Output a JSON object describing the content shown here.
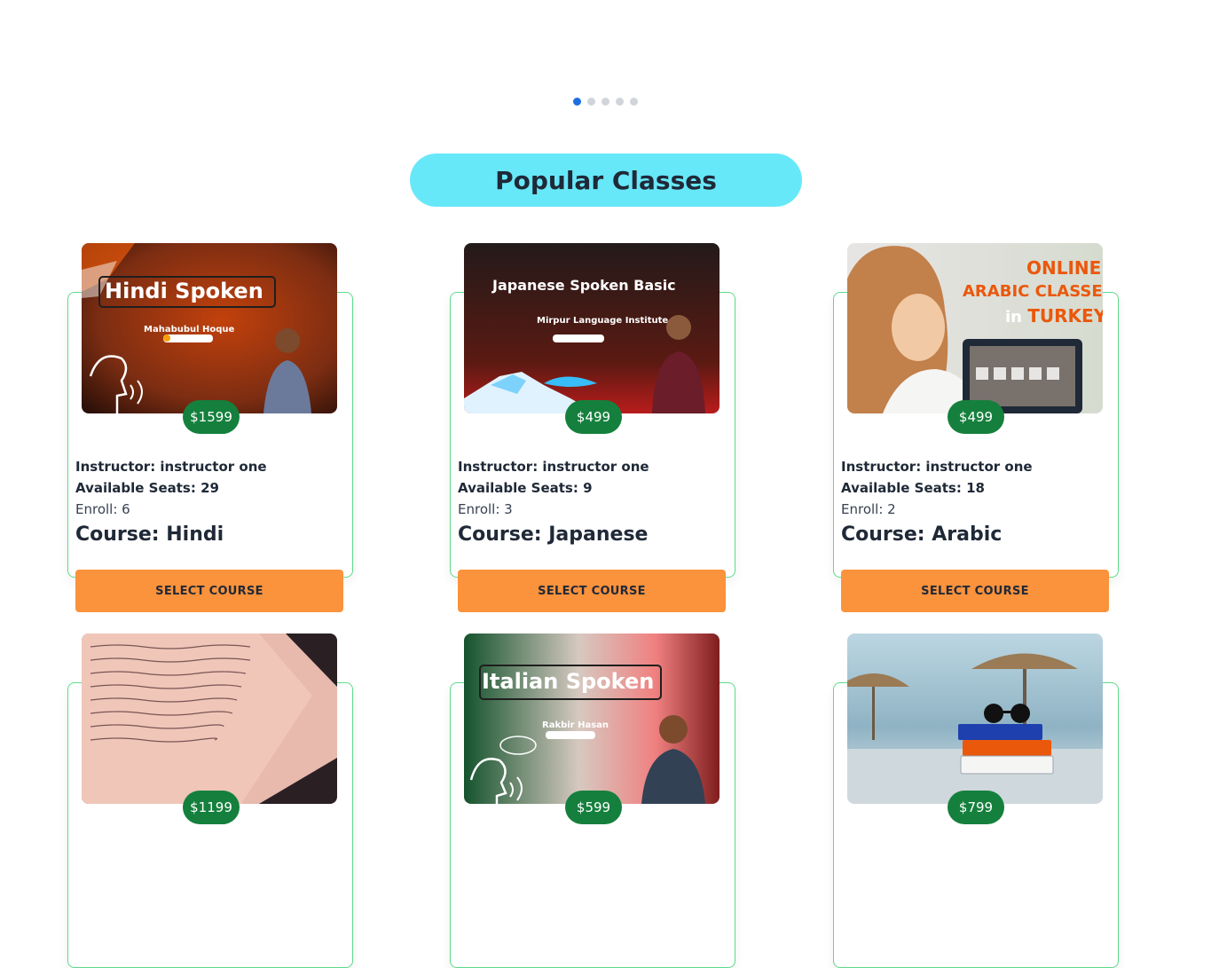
{
  "carousel": {
    "dot_count": 5,
    "active_index": 0
  },
  "section": {
    "title": "Popular Classes"
  },
  "labels": {
    "instructor_prefix": "Instructor: ",
    "seats_prefix": "Available Seats: ",
    "enroll_prefix": "Enroll: ",
    "course_prefix": "Course: ",
    "select_button": "SELECT COURSE"
  },
  "classes": [
    {
      "price": "$1599",
      "instructor": "Instructor: instructor one",
      "seats": "Available Seats: 29",
      "enroll": "Enroll: 6",
      "course": "Course: Hindi",
      "banner_title": "Hindi Spoken",
      "banner_sub": "Mahabubul Hoque"
    },
    {
      "price": "$499",
      "instructor": "Instructor: instructor one",
      "seats": "Available Seats: 9",
      "enroll": "Enroll: 3",
      "course": "Course: Japanese",
      "banner_title": "Japanese Spoken Basic",
      "banner_sub": "Mirpur Language Institute"
    },
    {
      "price": "$499",
      "instructor": "Instructor: instructor one",
      "seats": "Available Seats: 18",
      "enroll": "Enroll: 2",
      "course": "Course: Arabic",
      "banner_line1": "ONLINE",
      "banner_line2": "ARABIC CLASSES",
      "banner_line3a": "in ",
      "banner_line3b": "TURKEY"
    },
    {
      "price": "$1199"
    },
    {
      "price": "$599",
      "banner_title": "Italian Spoken",
      "banner_sub": "Rakbir Hasan"
    },
    {
      "price": "$799"
    }
  ],
  "colors": {
    "accent_pill": "#67e8f9",
    "price_badge": "#15803d",
    "select_button": "#fb923c",
    "card_border": "#5eda8a",
    "active_dot": "#1d6fe0"
  }
}
